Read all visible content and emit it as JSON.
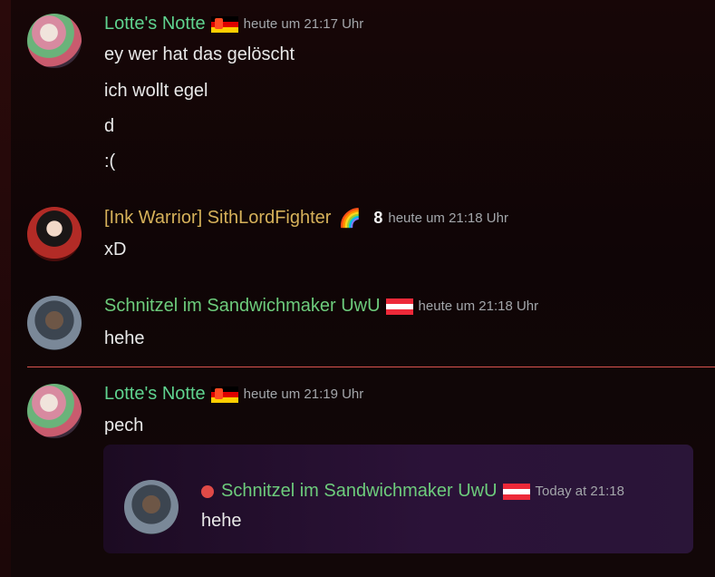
{
  "messages": [
    {
      "author": "Lotte's Notte",
      "timestamp": "heute um 21:17 Uhr",
      "lines": [
        "ey wer hat das gelöscht",
        "ich wollt egel",
        "d",
        ":("
      ]
    },
    {
      "author": "[Ink Warrior] SithLordFighter",
      "badge": "8",
      "timestamp": "heute um 21:18 Uhr",
      "lines": [
        "xD"
      ]
    },
    {
      "author": "Schnitzel im Sandwichmaker UwU",
      "timestamp": "heute um 21:18 Uhr",
      "lines": [
        "hehe"
      ]
    },
    {
      "author": "Lotte's Notte",
      "timestamp": "heute um 21:19 Uhr",
      "lines": [
        "pech"
      ]
    }
  ],
  "embed": {
    "author": "Schnitzel im Sandwichmaker UwU",
    "timestamp": "Today at 21:18",
    "text": "hehe"
  },
  "icons": {
    "flag_de": "german-flag-icon",
    "flag_at": "austrian-flag-icon",
    "rainbow": "rainbow-icon",
    "reply": "reply-icon"
  },
  "colors": {
    "name_green": "#5fd38f",
    "name_gold": "#d6b15a",
    "divider": "#d9534f"
  }
}
